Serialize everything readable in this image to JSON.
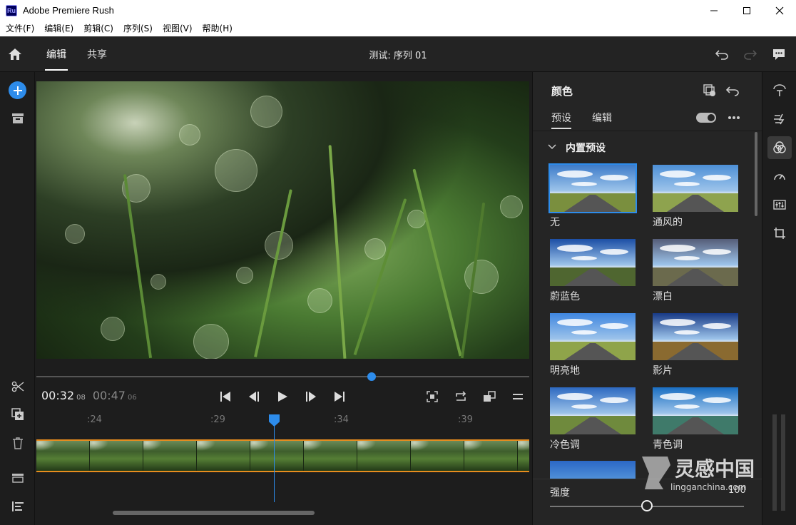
{
  "window": {
    "title": "Adobe Premiere Rush",
    "logo_text": "Ru",
    "controls": [
      "minimize",
      "maximize",
      "close"
    ]
  },
  "menu": [
    "文件(F)",
    "编辑(E)",
    "剪辑(C)",
    "序列(S)",
    "视图(V)",
    "帮助(H)"
  ],
  "appbar": {
    "tabs": [
      {
        "label": "编辑",
        "active": true
      },
      {
        "label": "共享",
        "active": false
      }
    ],
    "sequence_title": "测试: 序列 01"
  },
  "player": {
    "current_time": "00:32",
    "current_frames": "08",
    "duration_time": "00:47",
    "duration_frames": "06",
    "scrub_progress": 0.68
  },
  "timeline": {
    "ruler": [
      ":24",
      ":29",
      ":34",
      ":39"
    ],
    "clip_thumbnails": 10
  },
  "color_panel": {
    "title": "颜色",
    "tabs": [
      {
        "label": "预设",
        "active": true
      },
      {
        "label": "编辑",
        "active": false
      }
    ],
    "section": "内置预设",
    "presets": [
      {
        "label": "无",
        "selected": true,
        "sky": "#3d7bc9",
        "field": "#7a8f3e",
        "tint": "none"
      },
      {
        "label": "通风的",
        "selected": false,
        "sky": "#4d8fd6",
        "field": "#8ea34e",
        "tint": "none"
      },
      {
        "label": "蔚蓝色",
        "selected": false,
        "sky": "#1c4fa5",
        "field": "#4f6630",
        "tint": "none"
      },
      {
        "label": "漂白",
        "selected": false,
        "sky": "#555d78",
        "field": "#6b6a4d",
        "tint": "none"
      },
      {
        "label": "明亮地",
        "selected": false,
        "sky": "#3f86e0",
        "field": "#8fa44a",
        "tint": "none"
      },
      {
        "label": "影片",
        "selected": false,
        "sky": "#183a86",
        "field": "#8a6a30",
        "tint": "none"
      },
      {
        "label": "冷色调",
        "selected": false,
        "sky": "#2d69c0",
        "field": "#6f8a3d",
        "tint": "none"
      },
      {
        "label": "青色调",
        "selected": false,
        "sky": "#1a6fc2",
        "field": "#3f7a6a",
        "tint": "none"
      }
    ],
    "strength_label": "强度",
    "strength_value": "100",
    "strength_fraction": 0.5
  },
  "watermark": {
    "brand": "灵感中国",
    "url": "lingganchina.com"
  },
  "colors": {
    "accent": "#2d8ceb",
    "clip_border": "#e88c1e",
    "panel_bg": "#252525",
    "app_bg": "#1d1d1d"
  }
}
